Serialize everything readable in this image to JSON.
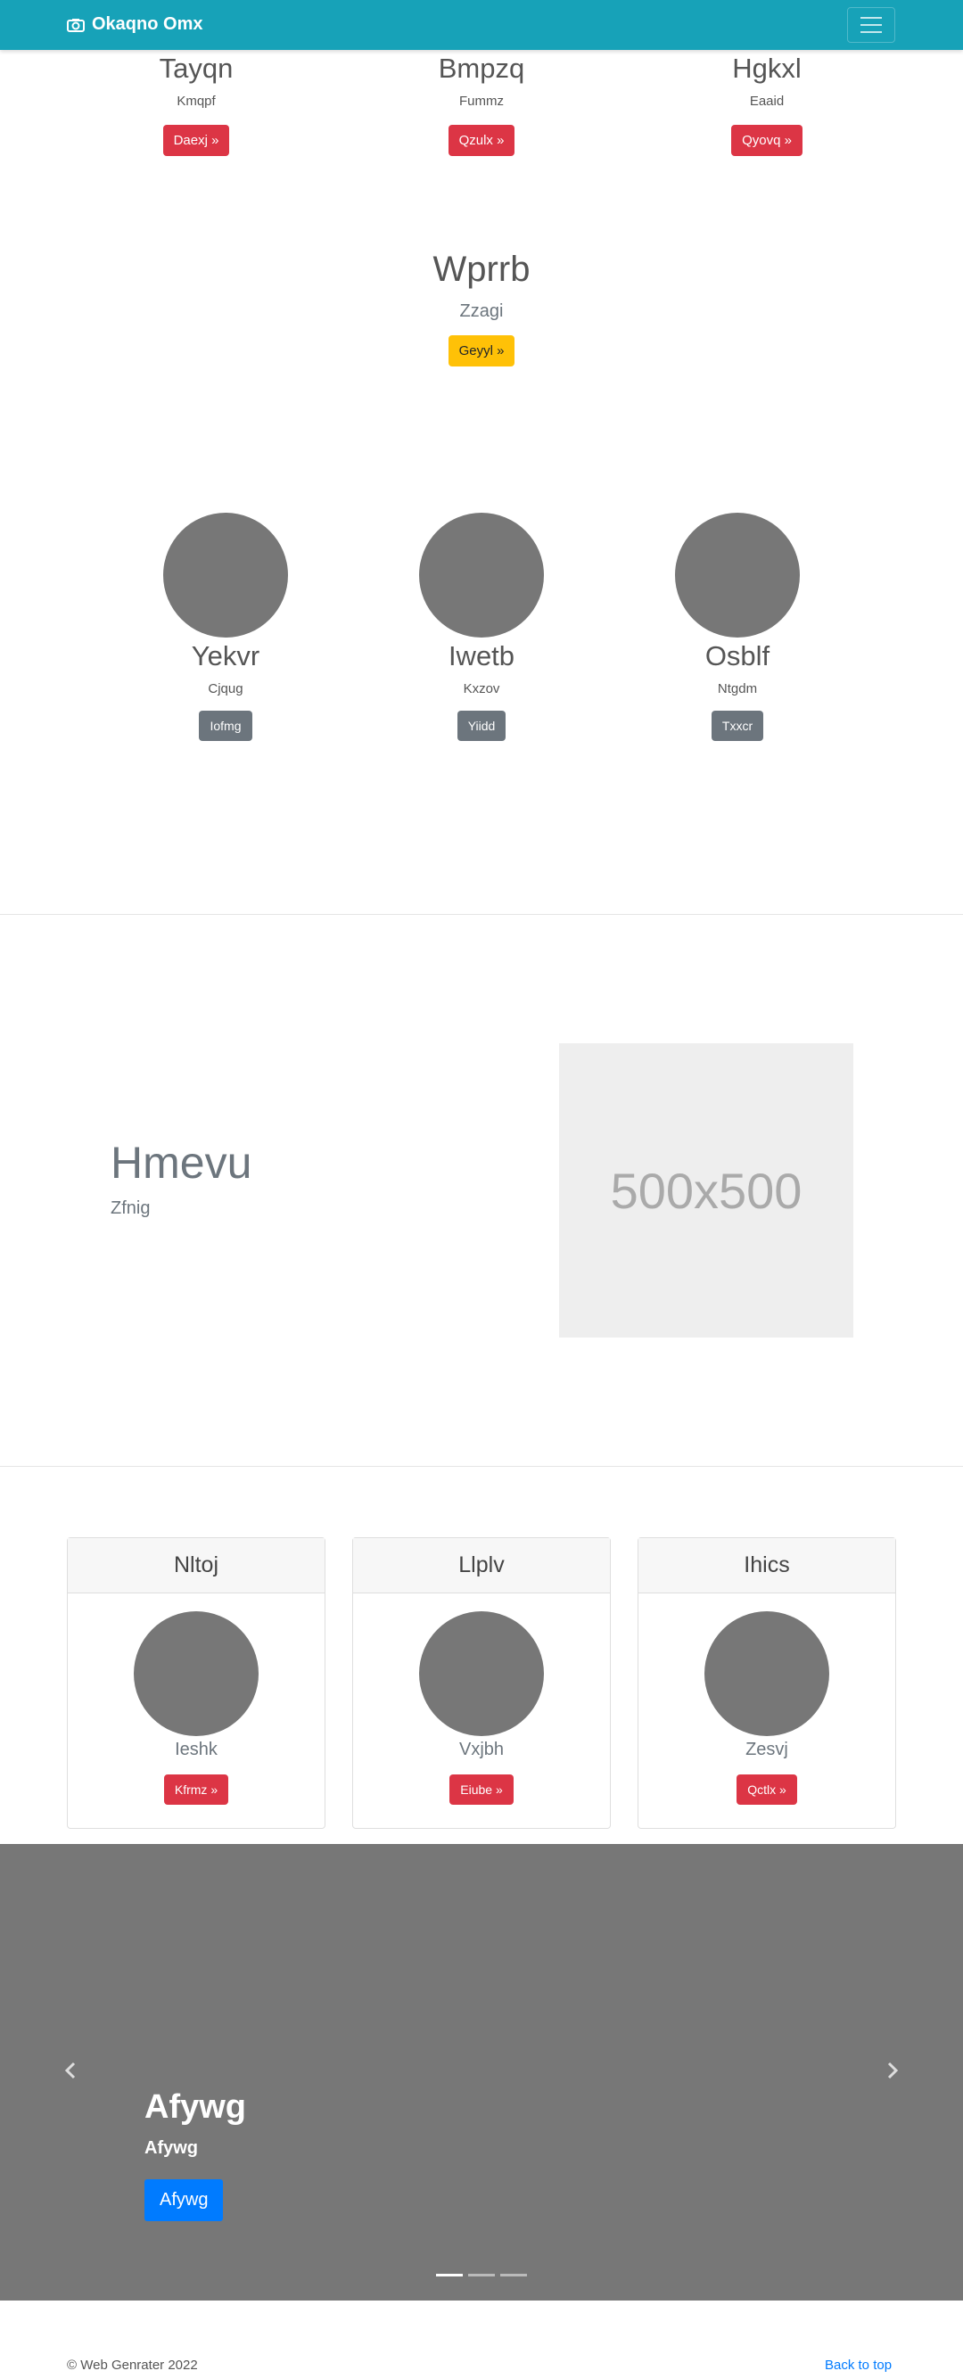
{
  "navbar": {
    "brand": "Okaqno Omx",
    "bg": "#17a2b8"
  },
  "top_trio": [
    {
      "title": "Tayqn",
      "subtitle": "Kmqpf",
      "button": "Daexj »"
    },
    {
      "title": "Bmpzq",
      "subtitle": "Fummz",
      "button": "Qzulx »"
    },
    {
      "title": "Hgkxl",
      "subtitle": "Eaaid",
      "button": "Qyovq »"
    }
  ],
  "center_block": {
    "title": "Wprrb",
    "subtitle": "Zzagi",
    "button": "Geyyl »"
  },
  "avatar_trio": [
    {
      "title": "Yekvr",
      "subtitle": "Cjqug",
      "button": "Iofmg"
    },
    {
      "title": "Iwetb",
      "subtitle": "Kxzov",
      "button": "Yiidd"
    },
    {
      "title": "Osblf",
      "subtitle": "Ntgdm",
      "button": "Txxcr"
    }
  ],
  "featurette": {
    "title": "Hmevu",
    "subtitle": "Zfnig",
    "placeholder": "500x500"
  },
  "cards": [
    {
      "header": "Nltoj",
      "text": "Ieshk",
      "button": "Kfrmz »"
    },
    {
      "header": "Llplv",
      "text": "Vxjbh",
      "button": "Eiube »"
    },
    {
      "header": "Ihics",
      "text": "Zesvj",
      "button": "Qctlx »"
    }
  ],
  "carousel": {
    "title": "Afywg",
    "subtitle": "Afywg",
    "button": "Afywg"
  },
  "footer": {
    "copyright": "© Web Genrater 2022",
    "back_to_top": "Back to top"
  }
}
